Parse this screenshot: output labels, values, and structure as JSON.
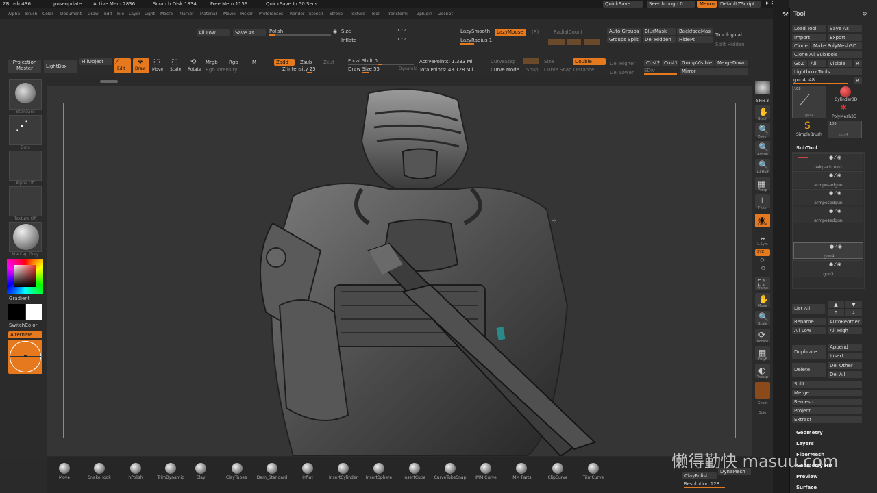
{
  "titlebar": {
    "app": "ZBrush 4R6",
    "doc": "poseupdate",
    "active_mem": "Active Mem 2836",
    "scratch_disk": "Scratch Disk 1834",
    "free_mem": "Free Mem 1159",
    "quicksave_in": "QuickSave In 50 Secs",
    "quicksave_btn": "QuickSave",
    "see_through": "See-through  0",
    "menus_btn": "Menus",
    "zscript": "DefaultZScript"
  },
  "menubar": [
    "Alpha",
    "Brush",
    "Color",
    "Document",
    "Draw",
    "Edit",
    "File",
    "Layer",
    "Light",
    "Macro",
    "Marker",
    "Material",
    "Movie",
    "Picker",
    "Preferences",
    "Render",
    "Stencil",
    "Stroke",
    "Texture",
    "Tool",
    "Transform",
    "Zplugin",
    "Zscript"
  ],
  "topshelf": {
    "all_low": "All Low",
    "save_as": "Save As",
    "polish": "Polish",
    "size": "Size",
    "inflate": "Inflate",
    "xyz1": "X Y Z",
    "xyz2": "X Y Z",
    "lazy_smooth": "LazySmooth",
    "lazy_mouse": "LazyMouse",
    "lazy_radius": "LazyRadius 1",
    "r": "(R)",
    "radial_count": "RadialCount",
    "auto_groups": "Auto Groups",
    "groups_split": "Groups Split",
    "blur_mask": "BlurMask",
    "del_hidden": "Del Hidden",
    "backface_mask": "BackfaceMas",
    "hide_pt": "HidePt",
    "topological": "Topological",
    "split_hidden": "Split Hidden",
    "projection_master": "Projection Master",
    "lightbox": "LightBox",
    "fill_object": "FillObject",
    "edit": "Edit",
    "draw": "Draw",
    "move": "Move",
    "scale": "Scale",
    "rotate": "Rotate",
    "mrgb": "Mrgb",
    "rgb": "Rgb",
    "m": "M",
    "rgb_intensity": "Rgb Intensity",
    "zadd": "Zadd",
    "zsub": "Zsub",
    "zcut": "Zcut",
    "z_intensity": "Z Intensity 25",
    "focal_shift": "Focal Shift 0",
    "draw_size": "Draw Size 55",
    "dynamic": "Dynamic",
    "active_points": "ActivePoints: 1.333 Mil",
    "total_points": "TotalPoints: 43.128 Mil",
    "curve_step": "CurveStep",
    "curve_mode": "Curve Mode",
    "snap": "Snap",
    "size2": "Size",
    "curve_snap_distance": "Curve Snap Distance",
    "double": "Double",
    "del_higher": "Del Higher",
    "del_lower": "Del Lower",
    "cust2": "Cust2",
    "cust1": "Cust1",
    "group_visible": "GroupVisible",
    "merge_down": "MergeDown",
    "sdiv": "SDiv",
    "mirror": "Mirror"
  },
  "leftshelf": {
    "standard": "Standard",
    "dots": "Dots",
    "alpha_off": "Alpha Off",
    "texture_off": "Texture Off",
    "matcap": "MatCap Gray",
    "gradient": "Gradient",
    "switch_color": "SwitchColor",
    "alternate": "Alternate"
  },
  "rightshelf": [
    "BPR",
    "SPix 3",
    "Scroll",
    "Zoom",
    "Actual",
    "AAHalf",
    "Persp",
    "Floor",
    "Local",
    "L.Sym",
    "XYZ",
    "",
    "Frame",
    "Move",
    "Scale",
    "Rotate",
    "PolyF",
    "Transp",
    "Ghost",
    "Solo"
  ],
  "bottom_brushes": [
    "Move",
    "SnakeHook",
    "hPolish",
    "TrimDynamic",
    "Clay",
    "ClayTubes",
    "Dam_Standard",
    "Inflat",
    "InsertCylinder",
    "InsertSphere",
    "InsertCube",
    "CurveTubeSnap",
    "IMM Curve",
    "IMM Parts",
    "ClipCurve",
    "TrimCurve"
  ],
  "tray": {
    "title": "Tool",
    "load_tool": "Load Tool",
    "save_as": "Save As",
    "import": "Import",
    "export": "Export",
    "clone": "Clone",
    "make_polymesh": "Make PolyMesh3D",
    "clone_all": "Clone All SubTools",
    "goz": "GoZ",
    "all": "All",
    "visible": "Visible",
    "r": "R",
    "lightbox_tools": "Lightbox› Tools",
    "current_tool": "gun4. 48",
    "tool_count": "108",
    "tool_count2": "108",
    "cylinder": "Cylinder3D",
    "polymesh": "PolyMesh3D",
    "simplebrush": "SimpleBrush",
    "gun4": "gun4",
    "gun4b": "gun4",
    "subtool_title": "SubTool",
    "subtools": [
      "bakpackcolo1",
      "armposedgun",
      "armposedgun",
      "armposedgun",
      "gun4",
      "gun3"
    ],
    "list_all": "List All",
    "rename": "Rename",
    "auto_reorder": "AutoReorder",
    "all_low": "All Low",
    "all_high": "All High",
    "duplicate": "Duplicate",
    "append": "Append",
    "insert": "Insert",
    "delete": "Delete",
    "del_other": "Del Other",
    "del_all": "Del All",
    "split": "Split",
    "merge": "Merge",
    "remesh": "Remesh",
    "project": "Project",
    "extract": "Extract",
    "geometry": "Geometry",
    "layers": "Layers",
    "fibermesh": "FiberMesh",
    "geometry_hd": "Geometry HD",
    "preview": "Preview",
    "surface": "Surface",
    "clay_polish": "ClayPolish",
    "dynamesh": "DynaMesh",
    "resolution": "Resolution 128"
  },
  "watermark": "懒得勤快 masuu.com"
}
